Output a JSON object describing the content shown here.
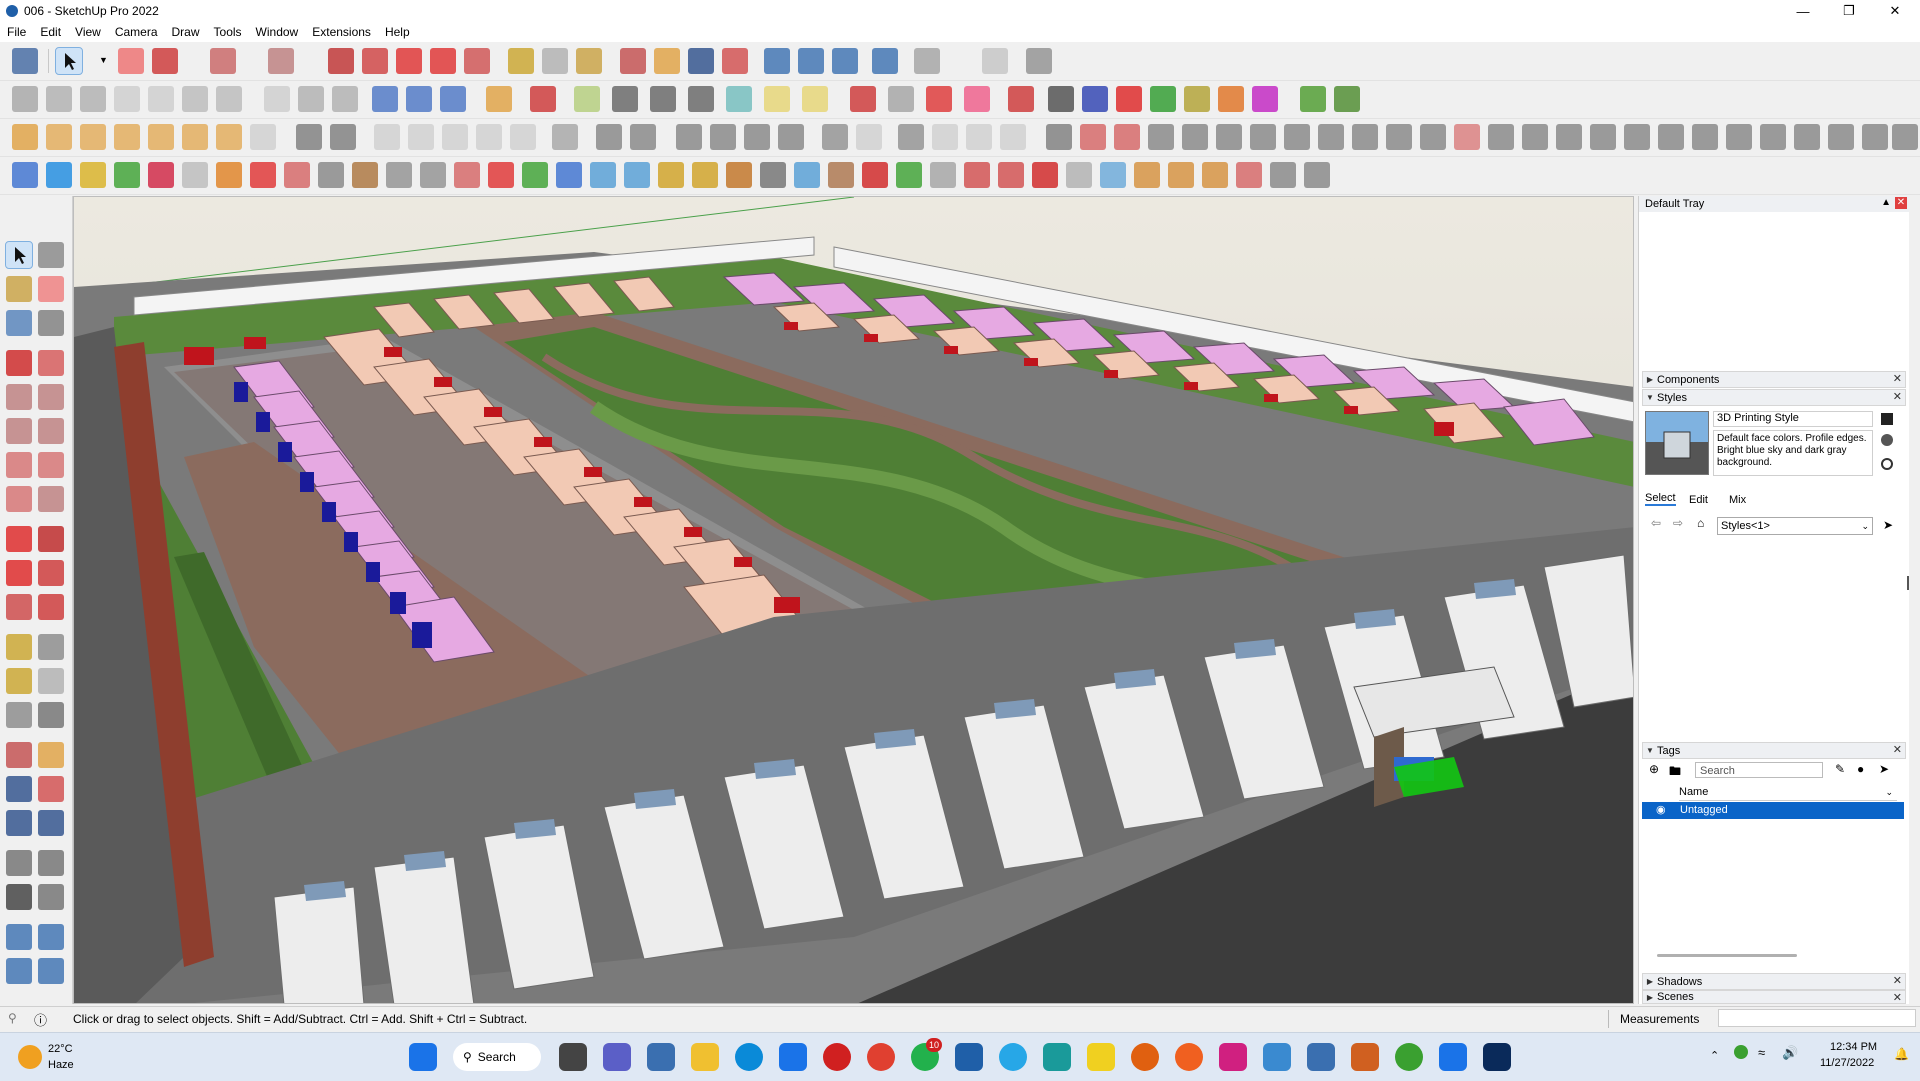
{
  "window": {
    "title": "006 - SketchUp Pro 2022"
  },
  "menu": [
    "File",
    "Edit",
    "View",
    "Camera",
    "Draw",
    "Tools",
    "Window",
    "Extensions",
    "Help"
  ],
  "tray": {
    "title": "Default Tray",
    "components_label": "Components",
    "styles": {
      "label": "Styles",
      "style_name": "3D Printing Style",
      "description": "Default face colors. Profile edges. Bright blue sky and dark gray background.",
      "tabs": [
        "Select",
        "Edit",
        "Mix"
      ],
      "dropdown_value": "Styles<1>"
    },
    "tags": {
      "label": "Tags",
      "search_placeholder": "Search",
      "column_name": "Name",
      "rows": [
        "Untagged"
      ]
    },
    "shadows_label": "Shadows",
    "scenes_label": "Scenes"
  },
  "status": {
    "message": "Click or drag to select objects. Shift = Add/Subtract. Ctrl = Add. Shift + Ctrl = Subtract.",
    "measurements_label": "Measurements"
  },
  "taskbar": {
    "weather_temp": "22°C",
    "weather_desc": "Haze",
    "search_label": "Search",
    "badge_count": "10",
    "time": "12:34 PM",
    "date": "11/27/2022"
  },
  "colors": {
    "selection_blue": "#0a64c8",
    "sky": "#e3e1da",
    "grass": "#4f7f35",
    "road": "#6d6d6d",
    "house_pink": "#f2c9b4",
    "house_lilac": "#e6a9e2",
    "roof_red": "#c0141c",
    "roof_blue": "#1a1a9a"
  },
  "icons": {
    "toolbar": [
      "zoom-icon",
      "select-icon",
      "eraser-icon",
      "pencil-icon",
      "arc-icon",
      "rectangle-icon",
      "push-pull-icon",
      "move-icon",
      "rotate-icon",
      "scale-icon",
      "tape-icon",
      "text-icon",
      "paint-icon",
      "orbit-icon",
      "pan-icon",
      "zoom-window-icon",
      "zoom-extents-icon"
    ],
    "left": [
      "select-icon",
      "orbit-icon",
      "paint-icon",
      "eraser-icon",
      "line-icon",
      "freehand-icon",
      "rectangle-icon",
      "rotated-rect-icon",
      "circle-icon",
      "polygon-icon",
      "arc-icon",
      "pie-icon",
      "move-icon",
      "push-pull-icon",
      "rotate-icon",
      "follow-me-icon",
      "scale-icon",
      "offset-icon",
      "tape-icon",
      "dimension-icon",
      "protractor-icon",
      "text-icon",
      "axes-icon",
      "3d-text-icon",
      "orbit-icon",
      "pan-icon",
      "zoom-icon",
      "zoom-window-icon",
      "zoom-extents-icon",
      "previous-icon",
      "position-camera-icon",
      "look-around-icon",
      "walk-icon",
      "section-plane-icon"
    ]
  }
}
